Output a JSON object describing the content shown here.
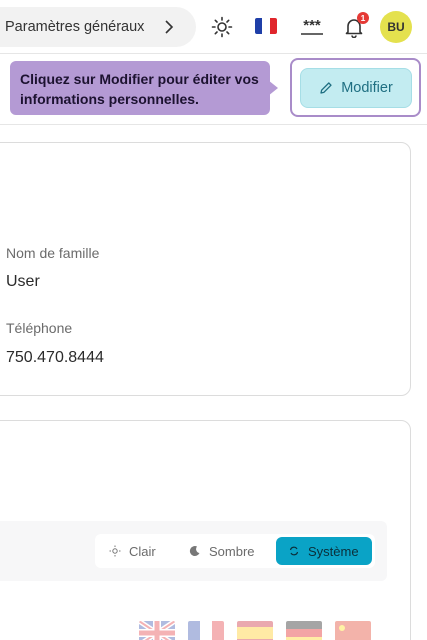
{
  "header": {
    "breadcrumb": "Paramètres généraux",
    "notification_count": "1",
    "avatar_initials": "BU",
    "password_mask": "***"
  },
  "tour": {
    "tooltip": "Cliquez sur Modifier pour éditer vos informations personnelles.",
    "modify_label": "Modifier"
  },
  "profile": {
    "last_name_label": "Nom de famille",
    "last_name": "User",
    "phone_label": "Téléphone",
    "phone": "750.470.8444"
  },
  "theme": {
    "options": [
      "Clair",
      "Sombre",
      "Système"
    ],
    "selected": "Système"
  },
  "colors": {
    "accent": "#0aa3c6",
    "tooltip": "#b49ad4",
    "avatar": "#e4e14e"
  }
}
